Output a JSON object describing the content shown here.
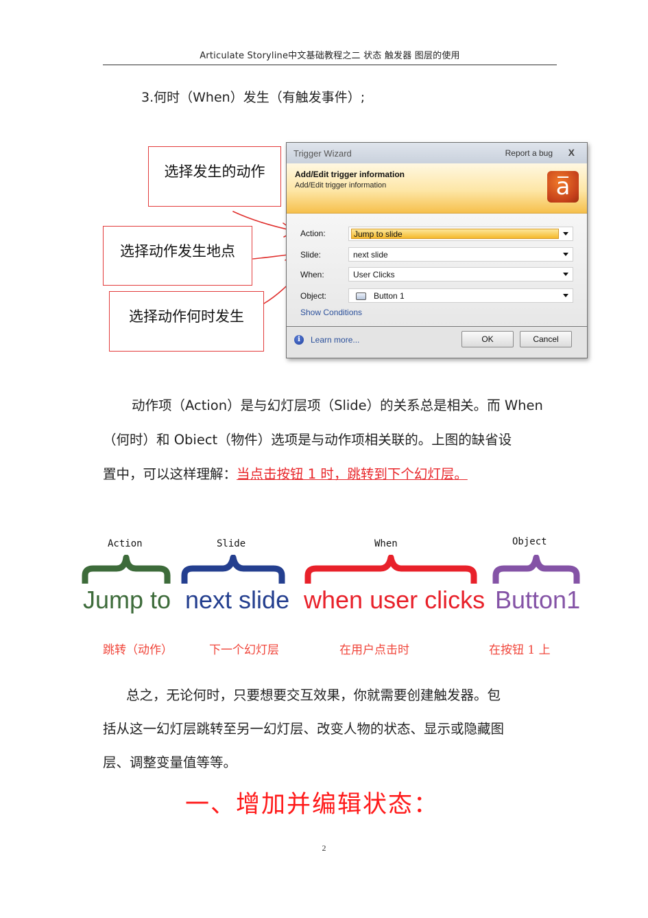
{
  "header": {
    "running_title": "Articulate  Storyline中文基础教程之二    状态  触发器  图层的使用"
  },
  "step_heading": "3.何时（When）发生（有触发事件）;",
  "callouts": [
    "选择发生的动作",
    "选择动作发生地点",
    "选择动作何时发生"
  ],
  "dialog": {
    "title": "Trigger Wizard",
    "report_bug": "Report a bug",
    "close": "X",
    "banner_title": "Add/Edit trigger information",
    "banner_subtitle": "Add/Edit trigger information",
    "logo_glyph": "a",
    "fields": [
      {
        "label": "Action:",
        "value": "Jump to slide"
      },
      {
        "label": "Slide:",
        "value": "next slide"
      },
      {
        "label": "When:",
        "value": "User Clicks"
      },
      {
        "label": "Object:",
        "value": "Button 1"
      }
    ],
    "show_conditions": "Show Conditions",
    "info_glyph": "i",
    "learn_more": "Learn more...",
    "ok": "OK",
    "cancel": "Cancel"
  },
  "paragraph1": {
    "lines": [
      "动作项（Action）是与幻灯层项（Slide）的关系总是相关。而 When",
      "（何时）和 Obiect（物件）选项是与动作项相关联的。上图的缺省设"
    ],
    "line3_prefix": "置中，可以这样理解：",
    "line3_highlight": "当点击按钮 1 时，跳转到下个幻灯层。"
  },
  "breakdown": {
    "items": [
      {
        "label": "Action",
        "text": "Jump to",
        "translation": "跳转（动作）",
        "color": "#3d6b3a"
      },
      {
        "label": "Slide",
        "text": "next slide",
        "translation": "下一个幻灯层",
        "color": "#243f8f"
      },
      {
        "label": "When",
        "text": "when user clicks",
        "translation": "在用户点击时",
        "color": "#e8212a"
      },
      {
        "label": "Object",
        "text": "Button1",
        "translation": "在按钮 1 上",
        "color": "#8453a6"
      }
    ]
  },
  "paragraph2": {
    "lines": [
      "总之，无论何时，只要想要交互效果，你就需要创建触发器。包",
      "括从这一幻灯层跳转至另一幻灯层、改变人物的状态、显示或隐藏图",
      "层、调整变量值等等。"
    ]
  },
  "section_heading": "一、增加并编辑状态：",
  "page_number": "2"
}
